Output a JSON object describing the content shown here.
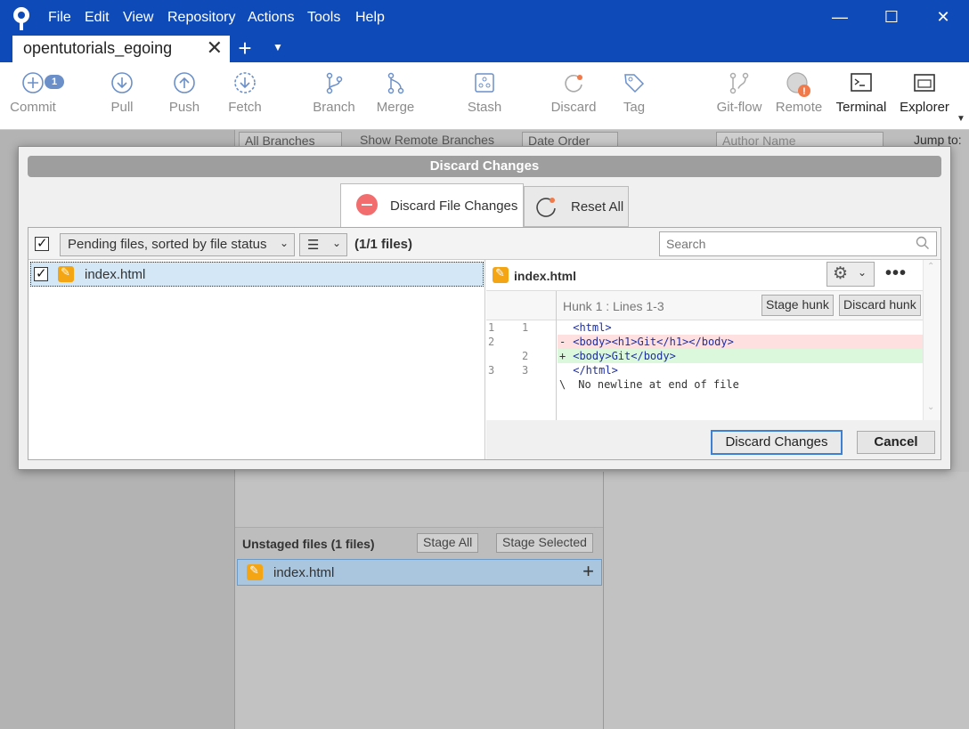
{
  "menu": [
    "File",
    "Edit",
    "View",
    "Repository",
    "Actions",
    "Tools",
    "Help"
  ],
  "window_controls": {
    "minimize": "—",
    "maximize": "☐",
    "close": "✕"
  },
  "repo_tab": {
    "label": "opentutorials_egoing",
    "close": "✕",
    "add": "+",
    "menu": "▼"
  },
  "toolbar": {
    "commit": "Commit",
    "commit_badge": "1",
    "pull": "Pull",
    "push": "Push",
    "fetch": "Fetch",
    "branch": "Branch",
    "merge": "Merge",
    "stash": "Stash",
    "discard": "Discard",
    "tag": "Tag",
    "gitflow": "Git-flow",
    "remote": "Remote",
    "terminal": "Terminal",
    "explorer": "Explorer"
  },
  "background": {
    "branches_filter": "All Branches",
    "show_remote": "Show Remote Branches",
    "order": "Date Order",
    "author_placeholder": "Author Name",
    "jump_to": "Jump to:",
    "unstaged_title": "Unstaged files   (1 files)",
    "stage_all": "Stage All",
    "stage_selected": "Stage Selected",
    "unstaged_file": "index.html"
  },
  "dialog": {
    "title": "Discard Changes",
    "tab_discard": "Discard File Changes",
    "tab_reset": "Reset All",
    "sort_dropdown": "Pending files, sorted by file status",
    "view_dropdown": "☰",
    "file_count": "(1/1 files)",
    "search_placeholder": "Search",
    "file_name": "index.html",
    "diff_file": "index.html",
    "hunk_label": "Hunk 1 : Lines 1-3",
    "stage_hunk": "Stage hunk",
    "discard_hunk": "Discard hunk",
    "more": "•••",
    "discard_button": "Discard Changes",
    "cancel_button": "Cancel"
  },
  "diff": [
    {
      "old": "1",
      "new": "1",
      "type": "ctx",
      "marker": " ",
      "code": "<html>"
    },
    {
      "old": "2",
      "new": "",
      "type": "del",
      "marker": "-",
      "code": "<body><h1>Git</h1></body>"
    },
    {
      "old": "",
      "new": "2",
      "type": "add",
      "marker": "+",
      "code": "<body>Git</body>"
    },
    {
      "old": "3",
      "new": "3",
      "type": "ctx",
      "marker": " ",
      "code": "</html>"
    },
    {
      "old": "",
      "new": "",
      "type": "note",
      "marker": "\\",
      "code": "No newline at end of file"
    }
  ],
  "colors": {
    "titlebar": "#0f4bb8",
    "accent": "#3c7fd3",
    "file_modified": "#f4a513"
  }
}
